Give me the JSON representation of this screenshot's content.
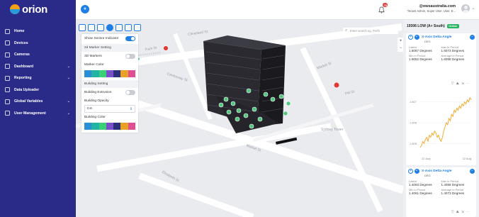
{
  "brand": {
    "name": "orion"
  },
  "nav": [
    {
      "label": "Home",
      "icon": "home-icon",
      "has_children": false
    },
    {
      "label": "Devices",
      "icon": "devices-icon",
      "has_children": false
    },
    {
      "label": "Cameras",
      "icon": "camera-icon",
      "has_children": false
    },
    {
      "label": "Dashboard",
      "icon": "dashboard-icon",
      "has_children": true
    },
    {
      "label": "Reporting",
      "icon": "reporting-icon",
      "has_children": true
    },
    {
      "label": "Data Uploader",
      "icon": "upload-icon",
      "has_children": false
    },
    {
      "label": "Global Variables",
      "icon": "variables-icon",
      "has_children": true
    },
    {
      "label": "User Management",
      "icon": "users-icon",
      "has_children": true
    }
  ],
  "topbar": {
    "collapse_glyph": "«",
    "notification_count": "75",
    "user_email": "@owsaustralia.com",
    "user_role": "Tenant Admin, Super User, User, E..."
  },
  "settings": {
    "show_sensor_indicator": "Show Sensor Indicator",
    "section_2d": "2d Marker Setting",
    "markers_3d": "3D Markers",
    "marker_color": "Marker Color",
    "section_building": "Building Setting",
    "building_extrusion": "Building Extrusion",
    "building_opacity": "Building Opacity",
    "opacity_value": "0.6",
    "building_color": "Building Color",
    "palette": [
      "#2b8fd6",
      "#21b3a3",
      "#3ccf7a",
      "#7a4fc9",
      "#2c2f7a",
      "#e8a127",
      "#e04f8f"
    ]
  },
  "map": {
    "search_placeholder": "Enter search eg. Perth",
    "zoom_in": "+",
    "zoom_out": "−",
    "streets": [
      "Cleveland St",
      "Market St",
      "Centreway St",
      "Park St",
      "Elizabeth St",
      "Sydney Tower",
      "Pitt St",
      "Market St"
    ]
  },
  "panel": {
    "title": "19306 LOW (A+ South)",
    "status": "Online",
    "cards": [
      {
        "title": "X-Axis Delta Angle",
        "unit": "DEG",
        "latest_label": "Latest",
        "latest_value": "1.6067 Degrees",
        "max_label": "Max in Period",
        "max_value": "1.6073 Degrees",
        "min_label": "Min in Period",
        "min_value": "1.6052 Degrees",
        "avg_label": "Average in Period",
        "avg_value": "1.6058 Degrees"
      },
      {
        "title": "X-Axis Delta Angle",
        "unit": "DEG",
        "latest_label": "Latest",
        "latest_value": "1.4063 Degrees",
        "max_label": "Max in Period",
        "max_value": "1.4068 Degrees",
        "min_label": "Min in Period",
        "min_value": "1.4061 Degrees",
        "avg_label": "Average in Period",
        "avg_value": "1.4073 Degrees"
      }
    ],
    "chart": {
      "y_ticks": [
        "1.607",
        "1.606",
        "1.605"
      ],
      "x_ticks": [
        "22 Aug",
        "22 Aug"
      ]
    }
  },
  "chart_data": {
    "type": "line",
    "title": "",
    "xlabel": "",
    "ylabel": "",
    "ylim": [
      1.6045,
      1.6075
    ],
    "x": [
      0,
      1,
      2,
      3,
      4,
      5,
      6,
      7,
      8,
      9,
      10,
      11,
      12,
      13,
      14,
      15,
      16,
      17,
      18,
      19,
      20,
      21,
      22,
      23,
      24,
      25,
      26,
      27,
      28,
      29,
      30,
      31,
      32,
      33,
      34,
      35,
      36,
      37,
      38,
      39
    ],
    "series": [
      {
        "values": [
          1.6048,
          1.6049,
          1.6051,
          1.605,
          1.6052,
          1.6053,
          1.6051,
          1.6054,
          1.6053,
          1.6055,
          1.6054,
          1.6056,
          1.6055,
          1.6053,
          1.6054,
          1.6052,
          1.6051,
          1.6053,
          1.6056,
          1.6058,
          1.606,
          1.6059,
          1.6062,
          1.6061,
          1.6064,
          1.6063,
          1.6066,
          1.6065,
          1.6067,
          1.6066,
          1.6068,
          1.6067,
          1.6069,
          1.6068,
          1.607,
          1.6069,
          1.6071,
          1.607,
          1.6072,
          1.6071
        ]
      }
    ],
    "color": "#f2a51d"
  }
}
